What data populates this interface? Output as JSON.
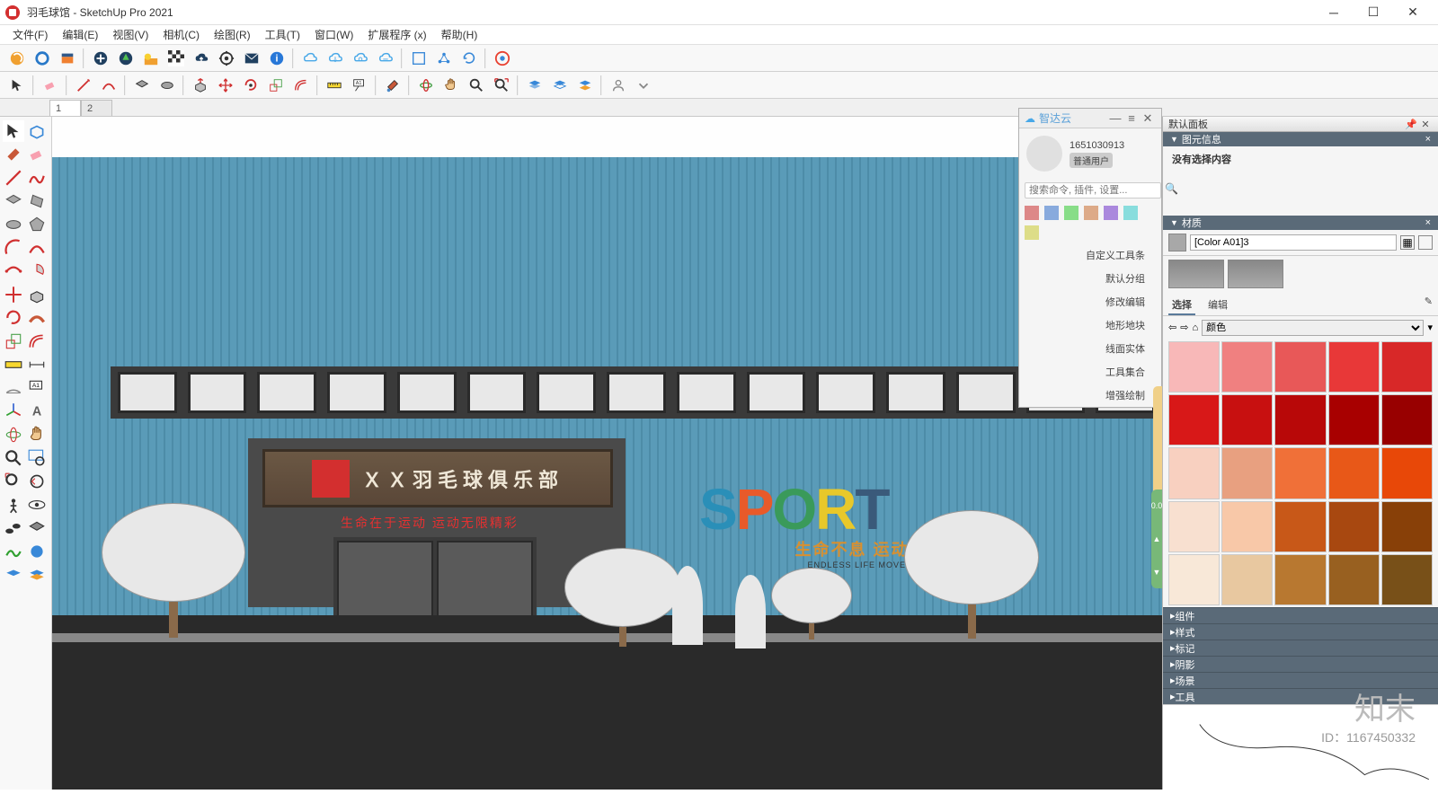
{
  "window": {
    "title": "羽毛球馆 - SketchUp Pro 2021"
  },
  "menus": {
    "file": "文件(F)",
    "edit": "编辑(E)",
    "view": "视图(V)",
    "camera": "相机(C)",
    "draw": "绘图(R)",
    "tools": "工具(T)",
    "window": "窗口(W)",
    "ext": "扩展程序 (x)",
    "help": "帮助(H)"
  },
  "tabs": {
    "t1": "1",
    "t2": "2"
  },
  "scene": {
    "sign_title": "ＸＸ羽毛球俱乐部",
    "banner": "生命在于运动 运动无限精彩",
    "sport_sub": "生命不息 运动不止",
    "sport_sub_en": "ENDLESS LIFE MOVEMENT"
  },
  "zhidayun": {
    "title": "智达云",
    "user_id": "1651030913",
    "user_badge": "普通用户",
    "search_placeholder": "搜索命令, 插件, 设置...",
    "menu": [
      "自定义工具条",
      "默认分组",
      "修改编辑",
      "地形地块",
      "线面实体",
      "工具集合",
      "增强绘制"
    ]
  },
  "default_panel": {
    "title": "默认面板",
    "sec_entity": "图元信息",
    "no_selection": "没有选择内容",
    "sec_materials": "材质",
    "material_name": "[Color A01]3",
    "tab_select": "选择",
    "tab_edit": "编辑",
    "dropdown": "颜色",
    "collapsed": [
      "组件",
      "样式",
      "标记",
      "阴影",
      "场景",
      "工具"
    ]
  },
  "swatch_colors": [
    "#f8b8b8",
    "#f08080",
    "#e85858",
    "#e83838",
    "#d82828",
    "#d81818",
    "#c81010",
    "#b80808",
    "#a80000",
    "#980000",
    "#f8d0c0",
    "#e8a080",
    "#f07038",
    "#e85818",
    "#e84808",
    "#f8e0d0",
    "#f8c8a8",
    "#c85818",
    "#a84810",
    "#884008",
    "#f8e8d8",
    "#e8c8a0",
    "#b87830",
    "#986020",
    "#785018"
  ],
  "watermark": {
    "logo": "知末",
    "id": "ID：1167450332"
  }
}
